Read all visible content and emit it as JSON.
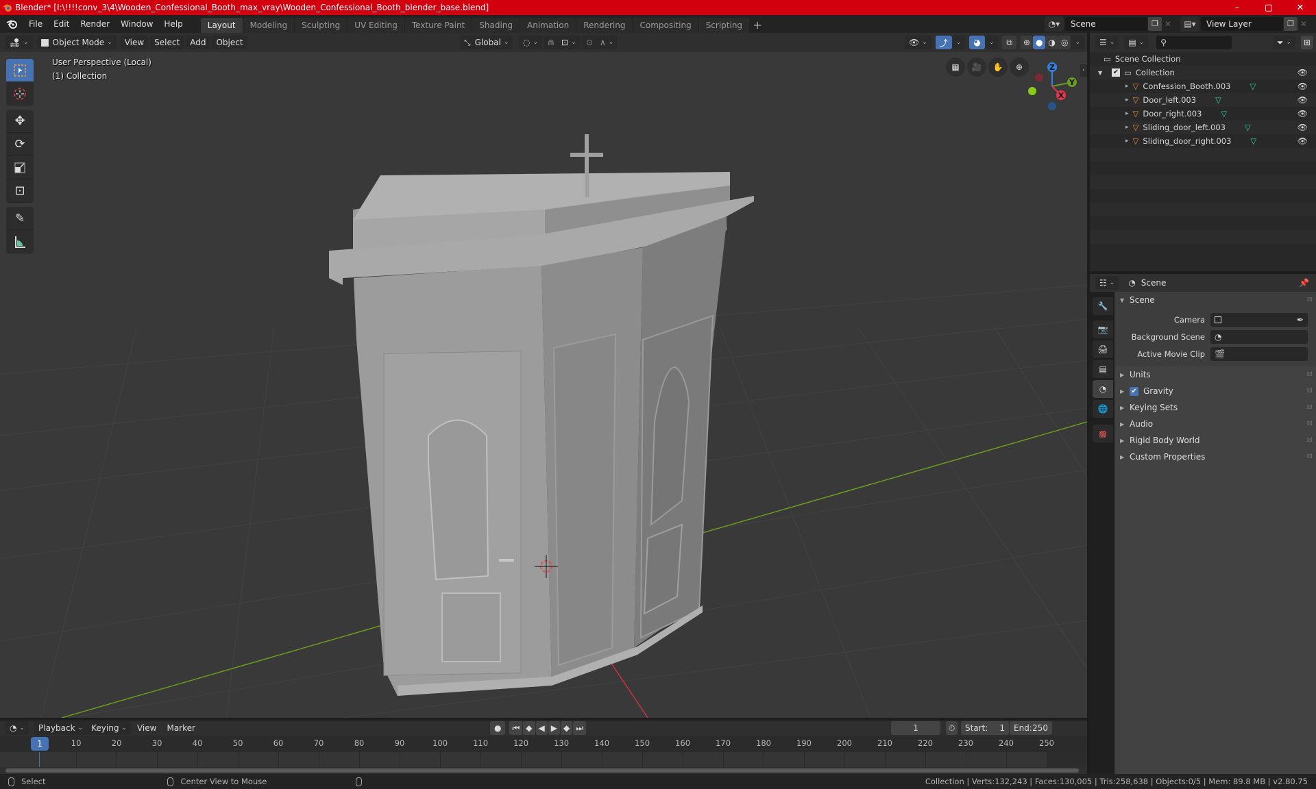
{
  "window": {
    "title": "Blender* [I:\\!!!!conv_3\\4\\Wooden_Confessional_Booth_max_vray\\Wooden_Confessional_Booth_blender_base.blend]",
    "controls": {
      "minimize": "–",
      "maximize": "▢",
      "close": "✕"
    }
  },
  "menu": {
    "items": [
      "File",
      "Edit",
      "Render",
      "Window",
      "Help"
    ]
  },
  "workspaces": {
    "tabs": [
      "Layout",
      "Modeling",
      "Sculpting",
      "UV Editing",
      "Texture Paint",
      "Shading",
      "Animation",
      "Rendering",
      "Compositing",
      "Scripting"
    ],
    "active": "Layout",
    "add_label": "+"
  },
  "scene_selector": {
    "value": "Scene"
  },
  "view_layer_selector": {
    "value": "View Layer"
  },
  "viewport_header": {
    "mode": "Object Mode",
    "menus": [
      "View",
      "Select",
      "Add",
      "Object"
    ],
    "transform_orientation": "Global"
  },
  "viewport": {
    "perspective_label": "User Perspective (Local)",
    "collection_label": "(1) Collection",
    "gizmo_axes": {
      "x": "X",
      "y": "Y",
      "z": "Z"
    },
    "colors": {
      "x": "#e8344d",
      "y": "#6c9b1e",
      "z": "#2f83e6"
    }
  },
  "toolbar": {
    "tools": [
      "select-box",
      "cursor",
      "move",
      "rotate",
      "scale",
      "transform",
      "annotate",
      "measure"
    ],
    "active": "select-box"
  },
  "outliner": {
    "root": "Scene Collection",
    "collection": "Collection",
    "objects": [
      "Confession_Booth.003",
      "Door_left.003",
      "Door_right.003",
      "Sliding_door_left.003",
      "Sliding_door_right.003"
    ]
  },
  "properties": {
    "context": "Scene",
    "panel_title": "Scene",
    "fields": [
      {
        "label": "Camera",
        "value": ""
      },
      {
        "label": "Background Scene",
        "value": ""
      },
      {
        "label": "Active Movie Clip",
        "value": ""
      }
    ],
    "subpanels": [
      "Units",
      "Gravity",
      "Keying Sets",
      "Audio",
      "Rigid Body World",
      "Custom Properties"
    ],
    "gravity_enabled": true
  },
  "timeline": {
    "menus": [
      "Playback",
      "Keying",
      "View",
      "Marker"
    ],
    "current_frame": "1",
    "start_label": "Start:",
    "start": "1",
    "end_label": "End:",
    "end": "250",
    "ticks": [
      "10",
      "20",
      "30",
      "40",
      "50",
      "60",
      "70",
      "80",
      "90",
      "100",
      "110",
      "120",
      "130",
      "140",
      "150",
      "160",
      "170",
      "180",
      "190",
      "200",
      "210",
      "220",
      "230",
      "240",
      "250"
    ]
  },
  "statusbar": {
    "left_action": "Select",
    "middle_action": "Center View to Mouse",
    "stats": "Collection | Verts:132,243 | Faces:130,005 | Tris:258,638 | Objects:0/5 | Mem: 89.8 MB | v2.80.75"
  }
}
